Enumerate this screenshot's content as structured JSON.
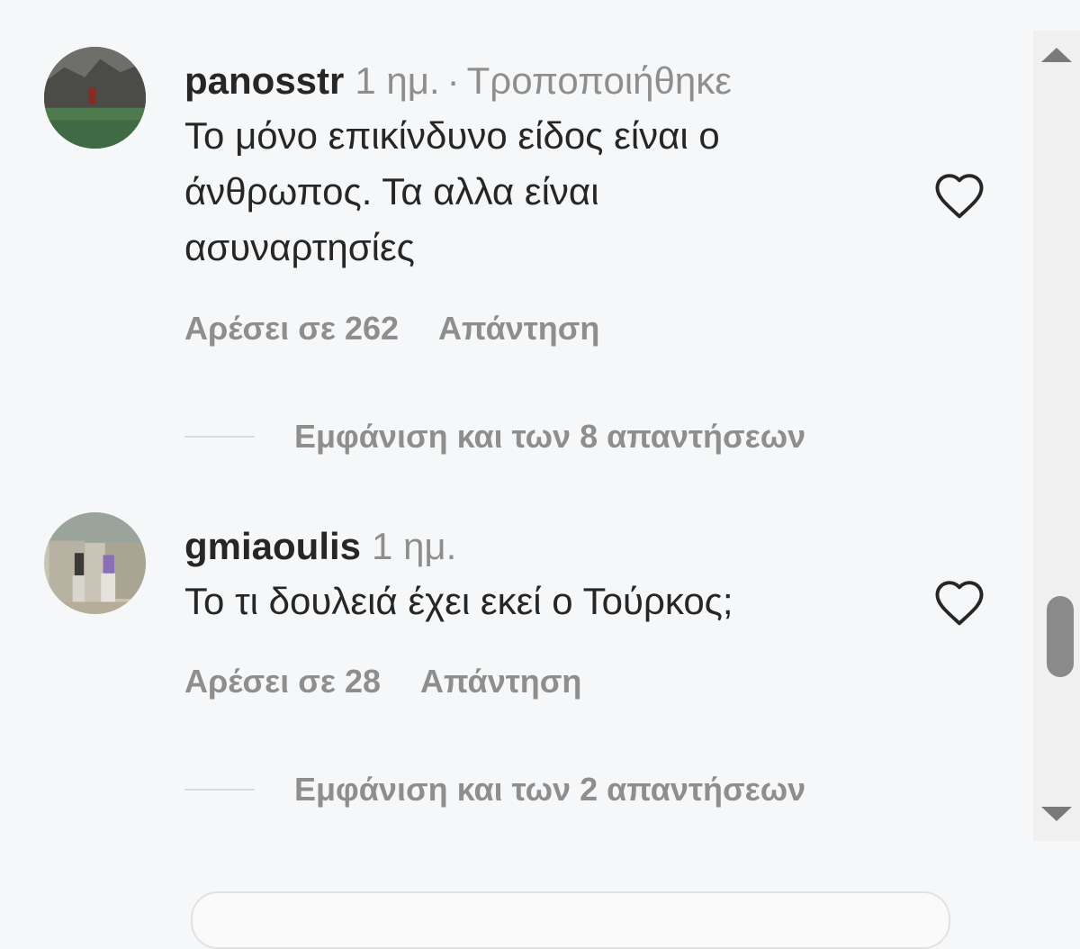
{
  "comments": [
    {
      "username": "panosstr",
      "time": "1 ημ.",
      "edited": "Τροποποιήθηκε",
      "text_lines": [
        "Το μόνο επικίνδυνο είδος είναι ο",
        "άνθρωπος. Τα αλλα είναι",
        "ασυναρτησίες"
      ],
      "likes_label": "Αρέσει σε 262",
      "reply_label": "Απάντηση",
      "view_replies_label": "Εμφάνιση και των 8 απαντήσεων"
    },
    {
      "username": "gmiaoulis",
      "time": "1 ημ.",
      "text_lines": [
        "Το τι δουλειά έχει εκεί ο Τούρκος;"
      ],
      "likes_label": "Αρέσει σε 28",
      "reply_label": "Απάντηση",
      "view_replies_label": "Εμφάνιση και των 2 απαντήσεων"
    }
  ],
  "icons": {
    "like": "heart-outline-icon",
    "scroll_up": "triangle-up-icon",
    "scroll_down": "triangle-down-icon"
  },
  "colors": {
    "text_primary": "#262626",
    "text_secondary": "#8e8e8e",
    "divider": "#dbdbdb",
    "background": "#f6f7f8"
  }
}
